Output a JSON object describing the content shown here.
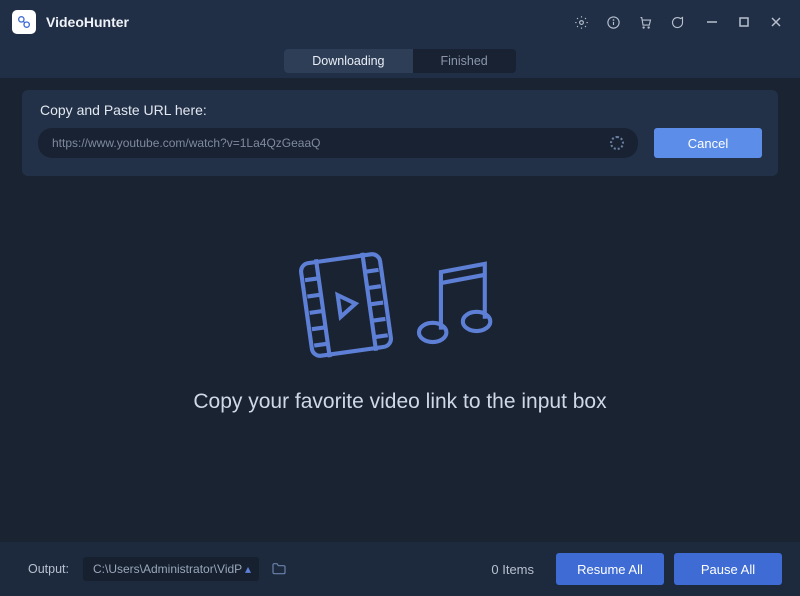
{
  "app": {
    "title": "VideoHunter"
  },
  "tabs": {
    "downloading": "Downloading",
    "finished": "Finished",
    "active": "downloading"
  },
  "url_section": {
    "label": "Copy and Paste URL here:",
    "value": "https://www.youtube.com/watch?v=1La4QzGeaaQ",
    "cancel_label": "Cancel"
  },
  "empty_state": {
    "message": "Copy your favorite video link to the input box"
  },
  "bottom": {
    "output_label": "Output:",
    "output_path": "C:\\Users\\Administrator\\VidP",
    "items_count_text": "0 Items",
    "resume_label": "Resume All",
    "pause_label": "Pause All"
  }
}
